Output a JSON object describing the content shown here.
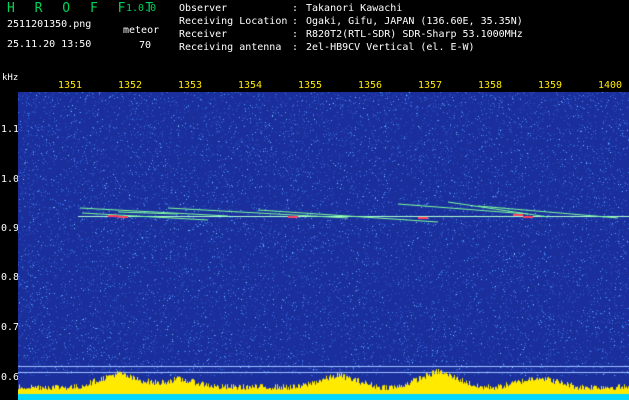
{
  "header": {
    "app_name": "H R O F F T",
    "version": "1.0.0",
    "file_name": "2511201350.png",
    "datetime": "25.11.20 13:50",
    "mode": "meteor",
    "count": "70",
    "info": [
      {
        "label": "Observer",
        "value": "Takanori Kawachi"
      },
      {
        "label": "Receiving Location",
        "value": "Ogaki, Gifu, JAPAN (136.60E, 35.35N)"
      },
      {
        "label": "Receiver",
        "value": "R820T2(RTL-SDR) SDR-Sharp 53.1000MHz"
      },
      {
        "label": "Receiving antenna",
        "value": "2el-HB9CV Vertical (el. E-W)"
      }
    ]
  },
  "axis": {
    "y_unit": "kHz",
    "x_ticks": [
      "1351",
      "1352",
      "1353",
      "1354",
      "1355",
      "1356",
      "1357",
      "1358",
      "1359",
      "1400"
    ],
    "y_ticks": [
      "1.1",
      "1.0",
      "0.9",
      "0.8",
      "0.7",
      "0.6"
    ]
  },
  "colors": {
    "background": "#1a2f9c",
    "noise": "#3a78e8",
    "signal": "#7dff9a",
    "meteor": "#ff4060",
    "carrier": "#b0ffd0",
    "level_bar": "#ffea00",
    "level_base": "#00d8ff"
  }
}
